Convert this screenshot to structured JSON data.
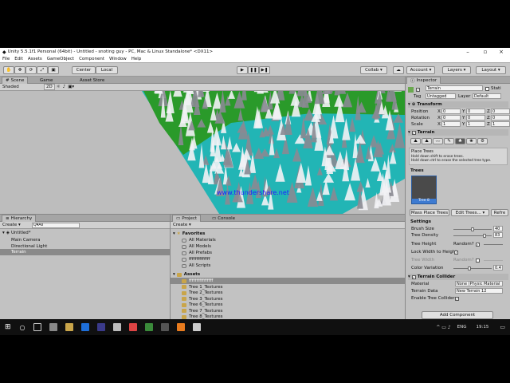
{
  "window": {
    "title": "Unity 5.5.1f1 Personal (64bit) - Untitled - snoting guy - PC, Mac & Linux Standalone* <DX11>"
  },
  "menu": [
    "File",
    "Edit",
    "Assets",
    "GameObject",
    "Component",
    "Window",
    "Help"
  ],
  "toolbar": {
    "center": "Center",
    "local": "Local",
    "collab": "Collab",
    "account": "Account",
    "layers": "Layers",
    "layout": "Layout"
  },
  "scene": {
    "tabs": [
      "Scene",
      "Game",
      "Asset Store"
    ],
    "shading": "Shaded",
    "mode": "2D",
    "watermark": "www.thundershare.net"
  },
  "hierarchy": {
    "tab": "Hierarchy",
    "create": "Create",
    "search": "Q▾All",
    "scene": "Untitled*",
    "items": [
      "Main Camera",
      "Directional Light",
      "Terrain"
    ],
    "selected": 2
  },
  "project": {
    "tabs": [
      "Project",
      "Console"
    ],
    "create": "Create",
    "favorites_label": "Favorites",
    "favorites": [
      "All Materials",
      "All Models",
      "All Prefabs",
      "ffffffffffffff",
      "All Scripts"
    ],
    "assets_label": "Assets",
    "assets": [
      "ffffffffffffffff",
      "Tree 1_Textures",
      "Tree 2_Textures",
      "Tree 3_Textures",
      "Tree 6_Textures",
      "Tree 7_Textures",
      "Tree 8_Textures"
    ]
  },
  "inspector": {
    "tab": "Inspector",
    "object": "Terrain",
    "static": "Stati",
    "tag_label": "Tag",
    "tag": "Untagged",
    "layer_label": "Layer",
    "layer": "Default",
    "transform": {
      "label": "Transform",
      "rows": [
        {
          "name": "Position",
          "x": "0",
          "y": "0",
          "z": "0"
        },
        {
          "name": "Rotation",
          "x": "0",
          "y": "0",
          "z": "0"
        },
        {
          "name": "Scale",
          "x": "1",
          "y": "1",
          "z": "1"
        }
      ]
    },
    "terrain": {
      "label": "Terrain",
      "tool_title": "Place Trees",
      "hint1": "Hold down shift to erase trees.",
      "hint2": "Hold down ctrl to erase the selected tree type.",
      "trees_label": "Trees",
      "tree_item": "Tree 8",
      "mass_place": "Mass Place Trees",
      "edit_trees": "Edit Trees...",
      "refresh": "Refre",
      "settings_label": "Settings",
      "brush_size_label": "Brush Size",
      "brush_size": "40",
      "tree_density_label": "Tree Density",
      "tree_density": "83",
      "tree_height_label": "Tree Height",
      "random_label": "Random?",
      "lock_label": "Lock Width to Height",
      "tree_width_label": "Tree Width",
      "random_label2": "Random?",
      "color_var_label": "Color Variation",
      "color_var": "0.4"
    },
    "collider": {
      "label": "Terrain Collider",
      "material_label": "Material",
      "material": "None (Physic Material",
      "data_label": "Terrain Data",
      "data": "New Terrain 12",
      "enable_label": "Enable Tree Collider"
    },
    "add_component": "Add Component",
    "levels": {
      "brush_size": 0.5,
      "tree_density": 0.83,
      "color_var": 0.4
    }
  },
  "taskbar": {
    "lang": "ENG",
    "time": "19:15"
  },
  "colors": {
    "grass": "#2a9a2a",
    "water": "#22b5b5",
    "selected": "#3e7bd1"
  }
}
